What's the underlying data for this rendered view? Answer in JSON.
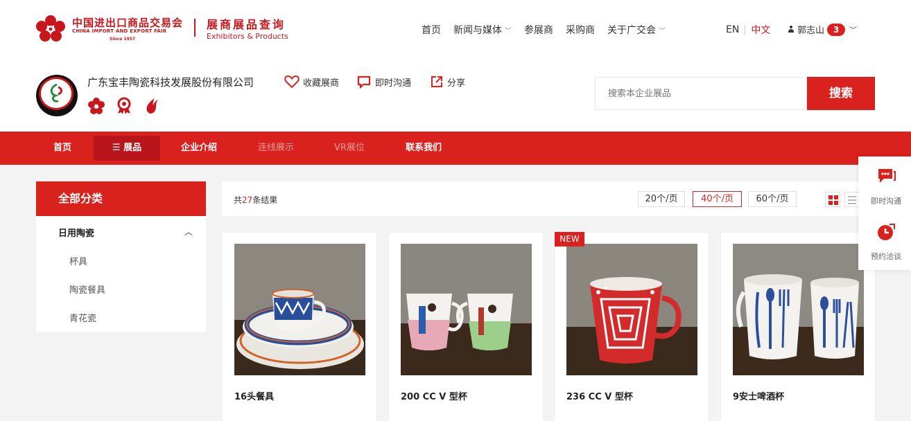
{
  "header": {
    "logo_cn": "中国进出口商品交易会",
    "logo_en": "CHINA IMPORT AND EXPORT FAIR",
    "logo_since": "Since 1957",
    "section_title": "展商展品查询",
    "section_title_en": "Exhibitors & Products",
    "nav": [
      {
        "label": "首页",
        "has_caret": false
      },
      {
        "label": "新闻与媒体",
        "has_caret": true
      },
      {
        "label": "参展商",
        "has_caret": false
      },
      {
        "label": "采购商",
        "has_caret": false
      },
      {
        "label": "关于广交会",
        "has_caret": true
      }
    ],
    "lang_en": "EN",
    "lang_zh": "中文",
    "user_name": "郭志山",
    "user_badge": "3"
  },
  "company": {
    "name": "广东宝丰陶瓷科技发展股份有限公司",
    "favorite": "收藏展商",
    "chat": "即时沟通",
    "share": "分享",
    "search_placeholder": "搜索本企业展品",
    "search_button": "搜索"
  },
  "subnav": {
    "items": [
      "首页",
      "展品",
      "企业介绍",
      "连线展示",
      "VR展位",
      "联系我们"
    ]
  },
  "sidebar": {
    "title": "全部分类",
    "category": "日用陶瓷",
    "subcategories": [
      "杯具",
      "陶瓷餐具",
      "青花瓷"
    ]
  },
  "toolbar": {
    "count_prefix": "共",
    "count": "27",
    "count_suffix": "条结果",
    "page_sizes": [
      "20个/页",
      "40个/页",
      "60个/页"
    ],
    "selected_page_size": "40个/页"
  },
  "products": [
    {
      "name": "16头餐具",
      "is_new": false
    },
    {
      "name": "200 CC V 型杯",
      "is_new": false
    },
    {
      "name": "236 CC V 型杯",
      "is_new": true
    },
    {
      "name": "9安士啤酒杯",
      "is_new": false
    }
  ],
  "new_tag": "NEW",
  "float_panel": {
    "chat_label": "即时沟通",
    "appointment_label": "预约洽谈"
  },
  "colors": {
    "brand_red": "#d9211e",
    "active_red": "#b8161a"
  }
}
